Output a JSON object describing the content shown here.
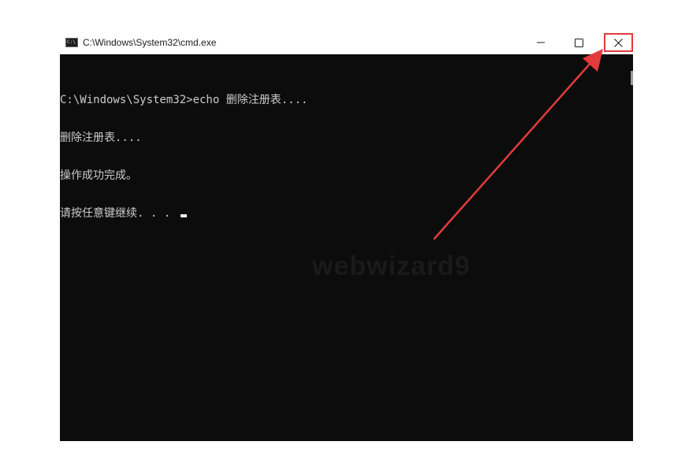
{
  "window": {
    "title": "C:\\Windows\\System32\\cmd.exe",
    "controls": {
      "minimize_icon": "minimize-icon",
      "maximize_icon": "maximize-icon",
      "close_icon": "close-icon"
    }
  },
  "console": {
    "lines": [
      "C:\\Windows\\System32>echo 删除注册表....",
      "删除注册表....",
      "操作成功完成。",
      "请按任意键继续. . . "
    ]
  },
  "watermark": "webwizard9",
  "annotation": {
    "highlight_color": "#e23b3b",
    "arrow_color": "#e23b3b",
    "target": "close-button"
  }
}
